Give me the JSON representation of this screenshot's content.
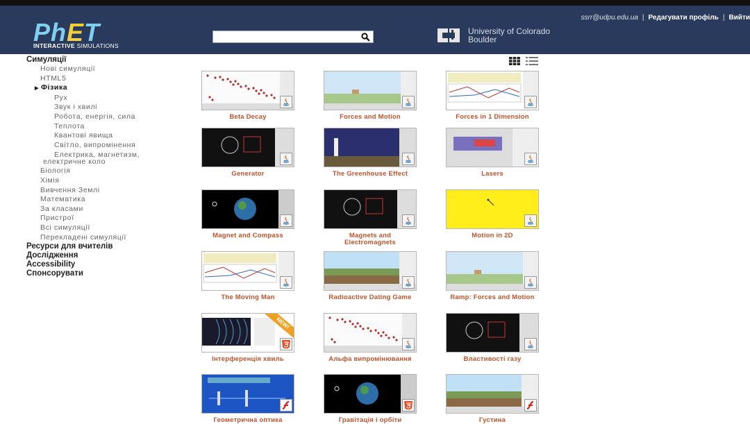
{
  "header": {
    "logo_text": "PhET",
    "logo_sub_bold": "INTERACTIVE",
    "logo_sub_rest": " SIMULATIONS",
    "search_placeholder": "",
    "university_line1": "University of Colorado",
    "university_line2": "Boulder",
    "user_email": "ssrr@udpu.edu.ua",
    "separator": "|",
    "edit_profile": "Редагувати профіль",
    "logout": "Вийти"
  },
  "sidebar": {
    "items": [
      {
        "label": "Симуляції",
        "level": 0
      },
      {
        "label": "Нові симуляції",
        "level": 1
      },
      {
        "label": "HTML5",
        "level": 1
      },
      {
        "label": "Фізика",
        "level": 1,
        "active": true
      },
      {
        "label": "Рух",
        "level": 2
      },
      {
        "label": "Звук і хвилі",
        "level": 2
      },
      {
        "label": "Робота, енергія, сила",
        "level": 2
      },
      {
        "label": "Теплота",
        "level": 2
      },
      {
        "label": "Квантові явища",
        "level": 2
      },
      {
        "label": "Світло, випромінення",
        "level": 2
      },
      {
        "label": "Електрика, магнетизм, електричне коло",
        "level": 2,
        "wrap": true
      },
      {
        "label": "Біологія",
        "level": 1
      },
      {
        "label": "Хімія",
        "level": 1
      },
      {
        "label": "Вивчення Землі",
        "level": 1
      },
      {
        "label": "Математика",
        "level": 1
      },
      {
        "label": "За класами",
        "level": 1
      },
      {
        "label": "Пристрої",
        "level": 1
      },
      {
        "label": "Всі симуляції",
        "level": 1
      },
      {
        "label": "Перекладені симуляції",
        "level": 1
      },
      {
        "label": "Ресурси для вчителів",
        "level": 0
      },
      {
        "label": "Дослідження",
        "level": 0
      },
      {
        "label": "Accessibility",
        "level": 0
      },
      {
        "label": "Спонсорувати",
        "level": 0
      }
    ]
  },
  "view_toggle": {
    "grid_icon": "grid-view-icon",
    "list_icon": "list-view-icon"
  },
  "sims": [
    {
      "title": "Beta Decay",
      "badge": "java",
      "theme": "white"
    },
    {
      "title": "Forces and Motion",
      "badge": "java",
      "theme": "sky"
    },
    {
      "title": "Forces in 1 Dimension",
      "badge": "java",
      "theme": "graph"
    },
    {
      "title": "Generator",
      "badge": "java",
      "theme": "dark"
    },
    {
      "title": "The Greenhouse Effect",
      "badge": "java",
      "theme": "night"
    },
    {
      "title": "Lasers",
      "badge": "java",
      "theme": "gray"
    },
    {
      "title": "Magnet and Compass",
      "badge": "java",
      "theme": "space"
    },
    {
      "title": "Magnets and Electromagnets",
      "badge": "java",
      "theme": "dark"
    },
    {
      "title": "Motion in 2D",
      "badge": "java",
      "theme": "yellow"
    },
    {
      "title": "The Moving Man",
      "badge": "java",
      "theme": "graph"
    },
    {
      "title": "Radioactive Dating Game",
      "badge": "java",
      "theme": "land"
    },
    {
      "title": "Ramp: Forces and Motion",
      "badge": "java",
      "theme": "sky"
    },
    {
      "title": "Інтерференція хвиль",
      "badge": "html5",
      "theme": "wave",
      "new": "NEW!"
    },
    {
      "title": "Альфа випромінювання",
      "badge": "java",
      "theme": "white"
    },
    {
      "title": "Властивості газу",
      "badge": "java",
      "theme": "dark"
    },
    {
      "title": "Геометрична оптика",
      "badge": "flash",
      "theme": "blue"
    },
    {
      "title": "Гравітація і орбіти",
      "badge": "html5",
      "theme": "space"
    },
    {
      "title": "Густина",
      "badge": "flash",
      "theme": "land"
    }
  ]
}
